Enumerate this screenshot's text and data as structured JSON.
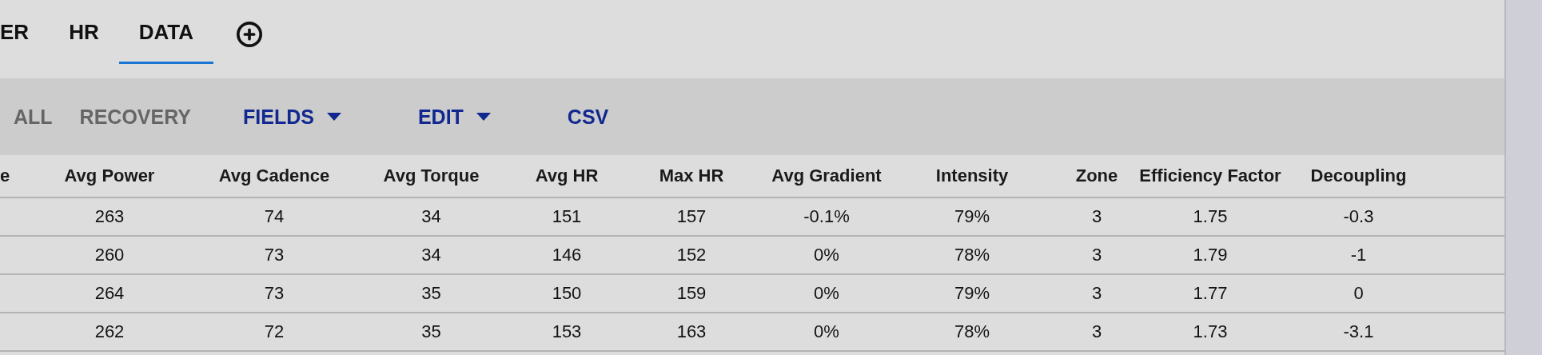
{
  "tabs": [
    {
      "label": "ER",
      "selected": false
    },
    {
      "label": "HR",
      "selected": false
    },
    {
      "label": "DATA",
      "selected": true
    }
  ],
  "toolbar": [
    {
      "label": "ALL",
      "kind": "filter"
    },
    {
      "label": "RECOVERY",
      "kind": "filter"
    },
    {
      "label": "FIELDS",
      "kind": "menu"
    },
    {
      "label": "EDIT",
      "kind": "menu"
    },
    {
      "label": "CSV",
      "kind": "action"
    }
  ],
  "table": {
    "columns": [
      "e",
      "Avg Power",
      "Avg Cadence",
      "Avg Torque",
      "Avg HR",
      "Max HR",
      "Avg Gradient",
      "Intensity",
      "Zone",
      "Efficiency Factor",
      "Decoupling"
    ],
    "rows": [
      [
        "",
        "263",
        "74",
        "34",
        "151",
        "157",
        "-0.1%",
        "79%",
        "3",
        "1.75",
        "-0.3"
      ],
      [
        "",
        "260",
        "73",
        "34",
        "146",
        "152",
        "0%",
        "78%",
        "3",
        "1.79",
        "-1"
      ],
      [
        "",
        "264",
        "73",
        "35",
        "150",
        "159",
        "0%",
        "79%",
        "3",
        "1.77",
        "0"
      ],
      [
        "",
        "262",
        "72",
        "35",
        "153",
        "163",
        "0%",
        "78%",
        "3",
        "1.73",
        "-3.1"
      ]
    ]
  }
}
